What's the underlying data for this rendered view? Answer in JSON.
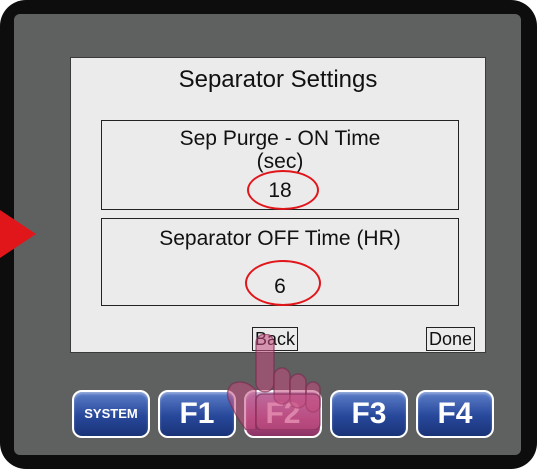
{
  "screen": {
    "title": "Separator Settings",
    "settings": [
      {
        "label_line1": "Sep Purge - ON Time",
        "label_line2": "(sec)",
        "value": "18"
      },
      {
        "label_line1": "Separator OFF Time (HR)",
        "value": "6"
      }
    ],
    "buttons": {
      "back": "Back",
      "done": "Done"
    }
  },
  "keys": [
    {
      "label": "SYSTEM"
    },
    {
      "label": "F1"
    },
    {
      "label": "F2",
      "pressed": true
    },
    {
      "label": "F3"
    },
    {
      "label": "F4"
    }
  ],
  "colors": {
    "highlight": "#e1161b",
    "key_blue": "#27479a",
    "key_pressed": "#b14f86",
    "panel_gray": "#5f6060"
  }
}
